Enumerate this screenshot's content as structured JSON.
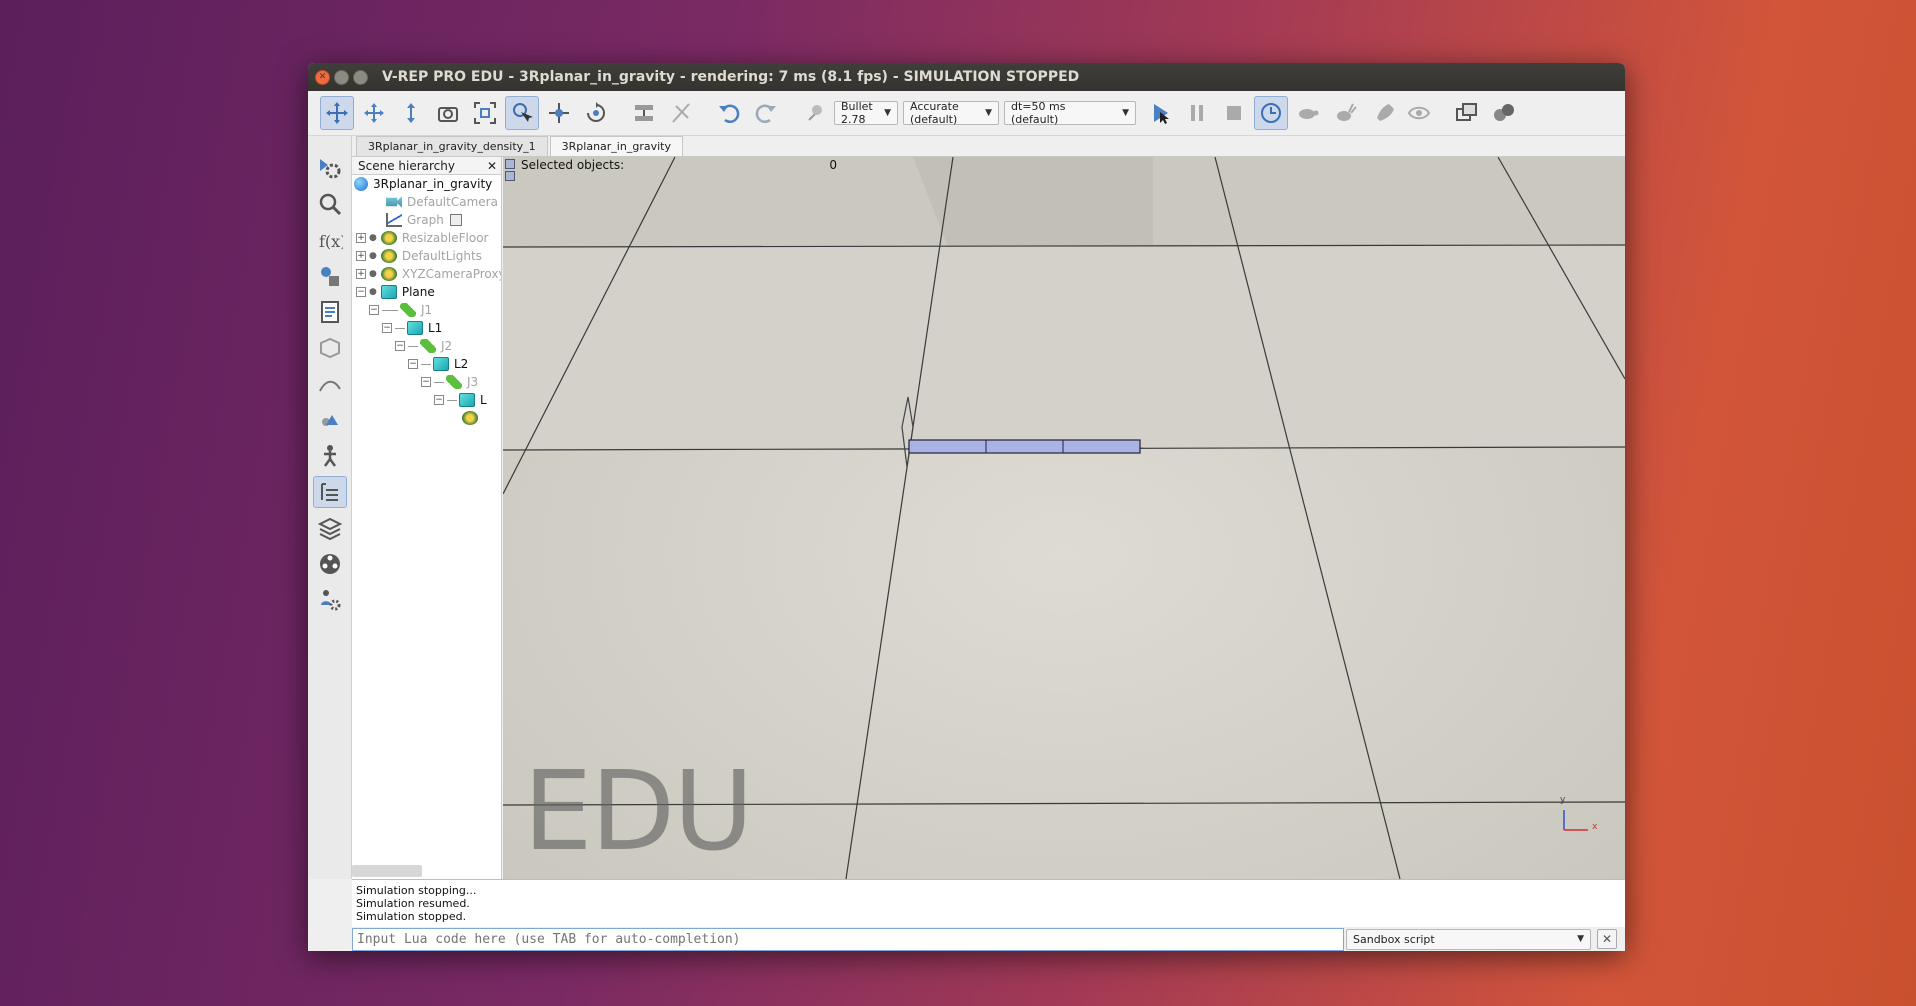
{
  "window": {
    "title": "V-REP PRO EDU - 3Rplanar_in_gravity - rendering: 7 ms (8.1 fps) - SIMULATION STOPPED"
  },
  "toolbar": {
    "physics_engine": "Bullet 2.78",
    "accuracy": "Accurate (default)",
    "timestep": "dt=50 ms (default)"
  },
  "tabs": [
    {
      "label": "3Rplanar_in_gravity_density_1"
    },
    {
      "label": "3Rplanar_in_gravity"
    }
  ],
  "hierarchy": {
    "title": "Scene hierarchy",
    "items": [
      {
        "label": "3Rplanar_in_gravity"
      },
      {
        "label": "DefaultCamera"
      },
      {
        "label": "Graph"
      },
      {
        "label": "ResizableFloor"
      },
      {
        "label": "DefaultLights"
      },
      {
        "label": "XYZCameraProxy"
      },
      {
        "label": "Plane"
      },
      {
        "label": "J1"
      },
      {
        "label": "L1"
      },
      {
        "label": "J2"
      },
      {
        "label": "L2"
      },
      {
        "label": "J3"
      },
      {
        "label": "L"
      }
    ]
  },
  "viewport": {
    "selected_label": "Selected objects:",
    "selected_value": "0",
    "watermark": "EDU",
    "axis_y": "y",
    "axis_x": "x"
  },
  "console": {
    "lines": [
      "Simulation stopping...",
      "Simulation resumed.",
      "Simulation stopped."
    ]
  },
  "lua_input": {
    "placeholder": "Input Lua code here (use TAB for auto-completion)"
  },
  "script_select": "Sandbox script"
}
